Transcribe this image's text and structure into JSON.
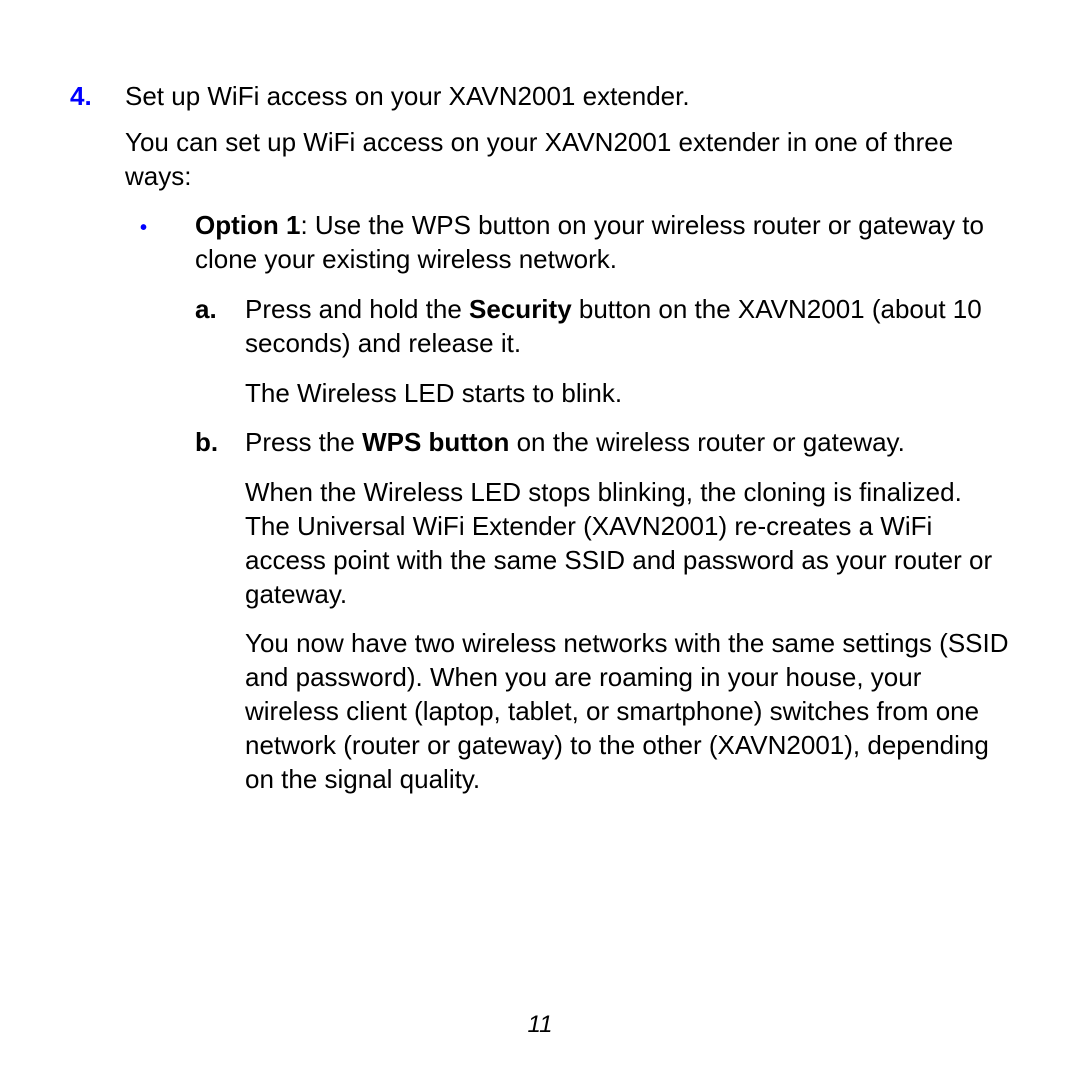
{
  "step": {
    "number": "4.",
    "title": "Set up WiFi access on your XAVN2001 extender.",
    "desc": "You can set up WiFi access on your XAVN2001 extender in one of three ways:"
  },
  "option1": {
    "label": "Option 1",
    "text": ": Use the WPS button on your wireless router or gateway to clone your existing wireless network."
  },
  "sub_a": {
    "marker": "a.",
    "pre": "Press and hold the ",
    "bold": "Security",
    "post": " button on the XAVN2001 (about 10 seconds) and release it.",
    "para1": "The Wireless LED starts to blink."
  },
  "sub_b": {
    "marker": "b.",
    "pre": "Press the ",
    "bold": "WPS button",
    "post": " on the wireless router or gateway.",
    "para1": "When the Wireless LED stops blinking, the cloning is finalized. The Universal WiFi Extender (XAVN2001) re-creates a WiFi access point with the same SSID and password as your router or gateway.",
    "para2": "You now have two wireless networks with the same settings (SSID and password). When you are roaming in your house, your wireless client (laptop, tablet, or smartphone) switches from one network (router or gateway) to the other (XAVN2001), depending on the signal quality."
  },
  "page_number": "11"
}
